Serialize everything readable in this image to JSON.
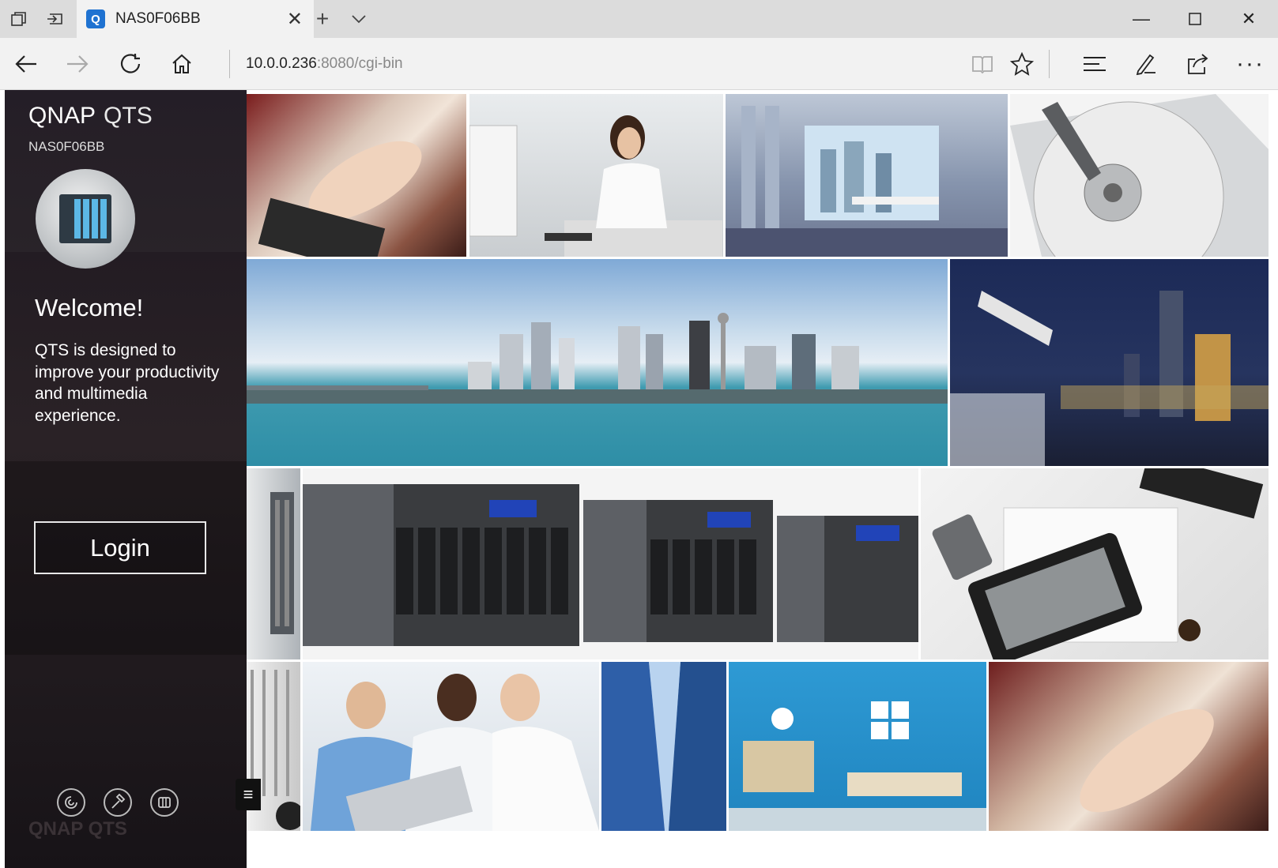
{
  "browser": {
    "tab_title": "NAS0F06BB",
    "tab_favicon": "Q",
    "address_host": "10.0.0.236",
    "address_rest": ":8080/cgi-bin"
  },
  "sidebar": {
    "brand_qnap": "QNAP",
    "brand_qts": "QTS",
    "hostname": "NAS0F06BB",
    "welcome": "Welcome!",
    "description": "QTS is designed to improve your productivity and multimedia experience.",
    "login_label": "Login",
    "watermark": "QNAP QTS"
  },
  "icons": {
    "back": "arrow-left-icon",
    "forward": "arrow-right-icon",
    "refresh": "refresh-icon",
    "home": "home-icon",
    "reading": "reading-view-icon",
    "favorite": "star-icon",
    "hub": "hub-icon",
    "notes": "pen-icon",
    "share": "share-icon",
    "more": "more-icon"
  }
}
